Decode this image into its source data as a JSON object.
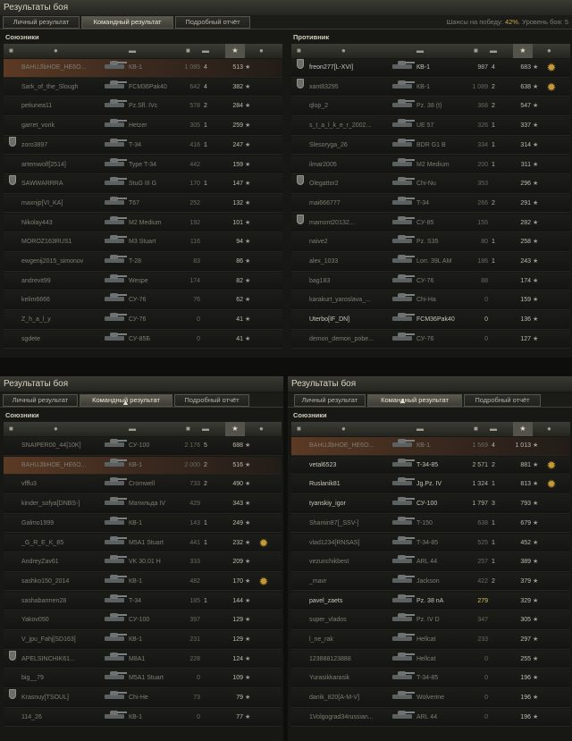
{
  "colors": {
    "player_highlight": "#5c3a24",
    "gold_damage": "#d6c257",
    "win_chance": "#c9a84a"
  },
  "icons": {
    "platoon": "platoon-shield-icon",
    "medal": "medal-icon",
    "tank": "tank-icon",
    "star": "star-icon"
  },
  "panel1": {
    "title": "Результаты боя",
    "tabs": [
      "Личный результат",
      "Командный результат",
      "Подробный отчёт"
    ],
    "odds_label": "Шансы на победу: ",
    "odds_value": "42%",
    "odds_suffix": ". Уровень боя: 5",
    "allies": {
      "title": "Союзники",
      "rows": [
        {
          "name": "BAHUJlbHOE_HE6O...",
          "vehicle": "КВ-1",
          "dmg": "1 085",
          "kills": "4",
          "xp": "513",
          "player": true
        },
        {
          "name": "Sark_of_the_Slough",
          "vehicle": "FCM36Pak40",
          "dmg": "642",
          "kills": "4",
          "xp": "382"
        },
        {
          "name": "petiunea11",
          "vehicle": "Pz.Sfl. IVc",
          "dmg": "578",
          "kills": "2",
          "xp": "284"
        },
        {
          "name": "garret_vorik",
          "vehicle": "Hetzer",
          "dmg": "305",
          "kills": "1",
          "xp": "259"
        },
        {
          "name": "zoro3897",
          "vehicle": "T-34",
          "dmg": "416",
          "kills": "1",
          "xp": "247",
          "platoon": true
        },
        {
          "name": "artemwolf[2514]",
          "vehicle": "Type T-34",
          "dmg": "442",
          "kills": "",
          "xp": "159"
        },
        {
          "name": "SAWWARRRA",
          "vehicle": "StuG III G",
          "dmg": "170",
          "kills": "1",
          "xp": "147",
          "platoon": true
        },
        {
          "name": "maxnjp[VI_KA]",
          "vehicle": "T67",
          "dmg": "252",
          "kills": "",
          "xp": "132"
        },
        {
          "name": "Nikolay443",
          "vehicle": "M2 Medium",
          "dmg": "192",
          "kills": "",
          "xp": "101"
        },
        {
          "name": "MOROZ163RUS1",
          "vehicle": "M3 Stuart",
          "dmg": "116",
          "kills": "",
          "xp": "94"
        },
        {
          "name": "ewgenij2015_simonov",
          "vehicle": "T-28",
          "dmg": "83",
          "kills": "",
          "xp": "86"
        },
        {
          "name": "andrevit99",
          "vehicle": "Wespe",
          "dmg": "174",
          "kills": "",
          "xp": "82"
        },
        {
          "name": "kelim6666",
          "vehicle": "СУ-76",
          "dmg": "76",
          "kills": "",
          "xp": "62"
        },
        {
          "name": "Z_h_a_l_y",
          "vehicle": "СУ-76",
          "dmg": "0",
          "kills": "",
          "xp": "41"
        },
        {
          "name": "sgdete",
          "vehicle": "СУ-85Б",
          "dmg": "0",
          "kills": "",
          "xp": "41"
        }
      ]
    },
    "enemies": {
      "title": "Противник",
      "rows": [
        {
          "name": "freon277[L-XVI]",
          "vehicle": "КВ-1",
          "dmg": "987",
          "kills": "4",
          "xp": "683",
          "platoon": true,
          "medal": true,
          "alive": true
        },
        {
          "name": "xant83295",
          "vehicle": "КВ-1",
          "dmg": "1 089",
          "kills": "2",
          "xp": "638",
          "platoon": true,
          "medal": true
        },
        {
          "name": "qlop_2",
          "vehicle": "Pz. 38 (t)",
          "dmg": "368",
          "kills": "2",
          "xp": "547"
        },
        {
          "name": "s_t_a_l_k_e_r_2002...",
          "vehicle": "UE 57",
          "dmg": "326",
          "kills": "1",
          "xp": "337"
        },
        {
          "name": "Slesoryga_26",
          "vehicle": "BDR G1 B",
          "dmg": "334",
          "kills": "1",
          "xp": "314"
        },
        {
          "name": "ilmar2005",
          "vehicle": "M2 Medium",
          "dmg": "200",
          "kills": "1",
          "xp": "311"
        },
        {
          "name": "Olegattor2",
          "vehicle": "Chi-Nu",
          "dmg": "353",
          "kills": "",
          "xp": "296",
          "platoon": true
        },
        {
          "name": "mai666777",
          "vehicle": "T-34",
          "dmg": "266",
          "kills": "2",
          "xp": "291"
        },
        {
          "name": "mamont20132...",
          "vehicle": "СУ-85",
          "dmg": "155",
          "kills": "",
          "xp": "282",
          "platoon": true
        },
        {
          "name": "naive2",
          "vehicle": "Pz. S35",
          "dmg": "80",
          "kills": "1",
          "xp": "258"
        },
        {
          "name": "alex_1033",
          "vehicle": "Lorr. 39L AM",
          "dmg": "186",
          "kills": "1",
          "xp": "243"
        },
        {
          "name": "bag183",
          "vehicle": "СУ-76",
          "dmg": "88",
          "kills": "",
          "xp": "174"
        },
        {
          "name": "karakurt_yaroslava_...",
          "vehicle": "Chi-Ha",
          "dmg": "0",
          "kills": "",
          "xp": "159"
        },
        {
          "name": "Uterbo[IF_DN]",
          "vehicle": "FCM36Pak40",
          "dmg": "0",
          "kills": "",
          "xp": "136",
          "alive": true
        },
        {
          "name": "demon_demon_pobe...",
          "vehicle": "СУ-76",
          "dmg": "0",
          "kills": "",
          "xp": "127"
        }
      ]
    }
  },
  "panel2": {
    "title": "Результаты боя",
    "tabs": [
      "Личный результат",
      "Командный результат",
      "Подробный отчёт"
    ],
    "allies": {
      "title": "Союзники",
      "rows": [
        {
          "name": "SNAIPER00_44[10K]",
          "vehicle": "СУ-100",
          "dmg": "2 176",
          "kills": "5",
          "xp": "688"
        },
        {
          "name": "BAHUJlbHOE_HE6O...",
          "vehicle": "КВ-1",
          "dmg": "2 000",
          "kills": "2",
          "xp": "516",
          "player": true
        },
        {
          "name": "vfffu3",
          "vehicle": "Cromwell",
          "dmg": "733",
          "kills": "2",
          "xp": "490"
        },
        {
          "name": "kinder_sofya[DNBS-]",
          "vehicle": "Матильда IV",
          "dmg": "429",
          "kills": "",
          "xp": "343"
        },
        {
          "name": "Galmo1999",
          "vehicle": "КВ-1",
          "dmg": "143",
          "kills": "1",
          "xp": "249"
        },
        {
          "name": "_G_R_E_K_85",
          "vehicle": "M5A1 Stuart",
          "dmg": "441",
          "kills": "1",
          "xp": "232",
          "medal": true
        },
        {
          "name": "AndreyZav61",
          "vehicle": "VK 30.01 H",
          "dmg": "333",
          "kills": "",
          "xp": "209"
        },
        {
          "name": "sashko150_2014",
          "vehicle": "КВ-1",
          "dmg": "482",
          "kills": "",
          "xp": "170",
          "medal": true
        },
        {
          "name": "sashabarmen28",
          "vehicle": "T-34",
          "dmg": "185",
          "kills": "1",
          "xp": "144"
        },
        {
          "name": "Yakov050",
          "vehicle": "СУ-100",
          "dmg": "397",
          "kills": "",
          "xp": "129"
        },
        {
          "name": "V_jpu_Fahj[SD163]",
          "vehicle": "КВ-1",
          "dmg": "231",
          "kills": "",
          "xp": "129"
        },
        {
          "name": "APELSINCHIK61...",
          "vehicle": "M8A1",
          "dmg": "228",
          "kills": "",
          "xp": "124",
          "platoon": true
        },
        {
          "name": "big__79",
          "vehicle": "M5A1 Stuart",
          "dmg": "0",
          "kills": "",
          "xp": "109"
        },
        {
          "name": "Krasnuy[TSOUL]",
          "vehicle": "Chi-He",
          "dmg": "73",
          "kills": "",
          "xp": "79",
          "platoon": true
        },
        {
          "name": "114_26",
          "vehicle": "КВ-1",
          "dmg": "0",
          "kills": "",
          "xp": "77"
        }
      ]
    }
  },
  "panel3": {
    "title": "Результаты боя",
    "tabs": [
      "Личный результат",
      "Командный результат",
      "Подробный отчёт"
    ],
    "allies": {
      "title": "Союзники",
      "rows": [
        {
          "name": "BAHUJlbHOE_HE6O...",
          "vehicle": "КВ-1",
          "dmg": "1 569",
          "kills": "4",
          "xp": "1 013",
          "player": true
        },
        {
          "name": "vetal6523",
          "vehicle": "T-34-85",
          "dmg": "2 571",
          "kills": "2",
          "xp": "881",
          "medal": true,
          "alive": true
        },
        {
          "name": "Ruslanik81",
          "vehicle": "Jg.Pz. IV",
          "dmg": "1 324",
          "kills": "1",
          "xp": "813",
          "medal": true,
          "alive": true
        },
        {
          "name": "tyanskiy_igor",
          "vehicle": "СУ-100",
          "dmg": "1 797",
          "kills": "3",
          "xp": "793",
          "alive": true
        },
        {
          "name": "Shamin87[_SSV-]",
          "vehicle": "T-150",
          "dmg": "638",
          "kills": "1",
          "xp": "679"
        },
        {
          "name": "vlad1234[RNSAS]",
          "vehicle": "T-34-85",
          "dmg": "525",
          "kills": "1",
          "xp": "452"
        },
        {
          "name": "vezunchikbest",
          "vehicle": "ARL 44",
          "dmg": "257",
          "kills": "1",
          "xp": "389"
        },
        {
          "name": "_mavr",
          "vehicle": "Jackson",
          "dmg": "422",
          "kills": "2",
          "xp": "379"
        },
        {
          "name": "pavel_zaets",
          "vehicle": "Pz. 38 nA",
          "dmg": "279",
          "kills": "",
          "xp": "329",
          "alive": true,
          "gold": true
        },
        {
          "name": "super_vlados",
          "vehicle": "Pz. IV D",
          "dmg": "347",
          "kills": "",
          "xp": "305"
        },
        {
          "name": "l_ne_rak",
          "vehicle": "Hellcat",
          "dmg": "233",
          "kills": "",
          "xp": "297"
        },
        {
          "name": "123888123888",
          "vehicle": "Hellcat",
          "dmg": "0",
          "kills": "",
          "xp": "255"
        },
        {
          "name": "Yurasikkarasik",
          "vehicle": "T-34-85",
          "dmg": "0",
          "kills": "",
          "xp": "196"
        },
        {
          "name": "danik_820[A-M-V]",
          "vehicle": "Wolverine",
          "dmg": "0",
          "kills": "",
          "xp": "196"
        },
        {
          "name": "1Volgograd34russian...",
          "vehicle": "ARL 44",
          "dmg": "0",
          "kills": "",
          "xp": "196"
        }
      ]
    }
  }
}
